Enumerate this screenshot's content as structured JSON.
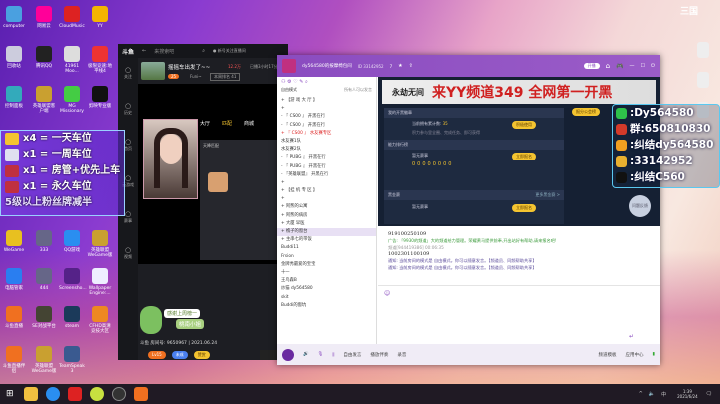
{
  "desktop_icons": [
    {
      "label": "computer",
      "color": "#4aa0e0"
    },
    {
      "label": "网易云",
      "color": "#f09"
    },
    {
      "label": "CloudMusic",
      "color": "#d22"
    },
    {
      "label": "YY",
      "color": "#f4b400"
    },
    {
      "label": "回收站",
      "color": "#ccd"
    },
    {
      "label": "腾讯QQ",
      "color": "#222"
    },
    {
      "label": "41961 Moo...",
      "color": "#ddd"
    },
    {
      "label": "极限竞速:地平线4",
      "color": "#e33"
    },
    {
      "label": "控制面板",
      "color": "#3ab"
    },
    {
      "label": "英雄联盟客户端",
      "color": "#c9a030"
    },
    {
      "label": "MG Missionary",
      "color": "#4c4"
    },
    {
      "label": "剪映专业版",
      "color": "#111"
    },
    {
      "label": "WeGame",
      "color": "#e8c020"
    },
    {
      "label": "333",
      "color": "#668"
    },
    {
      "label": "QQ游戏",
      "color": "#2a8ef0"
    },
    {
      "label": "英雄联盟WeGame版",
      "color": "#c9a030"
    },
    {
      "label": "电脑管家",
      "color": "#2a7ef0"
    },
    {
      "label": "444",
      "color": "#668"
    },
    {
      "label": "Screensho...",
      "color": "#528"
    },
    {
      "label": "Wallpaper Engine:...",
      "color": "#eef"
    },
    {
      "label": "斗鱼直播",
      "color": "#f07020"
    },
    {
      "label": "SE对战平台",
      "color": "#443"
    },
    {
      "label": "steam",
      "color": "#1b3a5a"
    },
    {
      "label": "CFHD高清竞技大区",
      "color": "#e82"
    },
    {
      "label": "斗鱼直播伴侣",
      "color": "#f07020"
    },
    {
      "label": "英雄联盟WeGame版",
      "color": "#c9a030"
    },
    {
      "label": "TeamSpeak 3",
      "color": "#3a5a90"
    }
  ],
  "right_icons": [
    {
      "label": "",
      "color": "#eee"
    },
    {
      "label": "",
      "color": "#eee"
    },
    {
      "label": "",
      "color": "#eee"
    }
  ],
  "douyu": {
    "search_placeholder": "来搜索吧",
    "follow_text": "● 新号关注直播间",
    "room_title": "摇摇车出发了~~",
    "hot": "12.2万",
    "online": "已播3小时17分",
    "level": "25",
    "anchor": "Funi~",
    "rank": "本周排名 41",
    "side": [
      "关注",
      "历史",
      "首页",
      "云游戏",
      "赛事",
      "视频"
    ],
    "tabs": [
      "大厅",
      "匹配",
      "商城"
    ],
    "team_label": "天降匹配",
    "footer": "斗鱼 房间号: 9650967 | 2021.06.24",
    "badges": [
      "Lv15",
      "未成",
      "赞赏"
    ],
    "sticker_text": [
      "感谢上周榜一",
      "桃南小姐"
    ]
  },
  "yy": {
    "channel_name": "dy564580的按摩椅包间",
    "channel_id": "ID 33142952",
    "members": "7",
    "top_btn": "开播",
    "mode": "自由模式",
    "mode_note": "所有人可以发言",
    "list": [
      "+ 【游 戏 大 厅 】",
      "+ ",
      "- 『 CS00 』 开黑在行",
      "- 『 CS00 』 开黑在行",
      "+ 『 CS00 』 水友赛专区",
      "水友赛1队",
      "水友赛2队",
      "- 『 PUBG 』 开黑在行",
      "- 『 PUBG 』 开黑在行",
      "- 『英雄联盟』 开黑在行",
      "+ ",
      "+ 【挂 机 专 区 】",
      "+ ",
      "+ 阿熊的公寓",
      "+ 阿熊的病房",
      "+ 大厦 早医",
      "+ 樵子的窗台",
      "+ 主串七的带饭",
      "Buddi11",
      "Frsion",
      "金牌秀最爱的宝宝",
      "十一",
      "王鸟森B",
      "炒猫 dy564580",
      "skit",
      "Buddi的窗坑"
    ],
    "banner": "来YY频道349 全网第一开黑",
    "banner_logo": "永劫无间",
    "sections": {
      "s1_title": "我的开黑徽章",
      "s1_text": "当前拥有累计数:",
      "s1_num": "35",
      "s1_sub": "积力参与里全圈、完成任务、即可获得",
      "s1_btn": "积极使用",
      "s2_title": "能力排行榜",
      "s2_name": "暂无赛事",
      "s2_btn": "立即报名",
      "digits": "00000000",
      "s3_title": "黑金赛",
      "s3_link": "更多黑金赛 >",
      "s3_name": "暂无赛事",
      "s3_btn": "立即报名",
      "side_btn": "报分公会榜",
      "help": "问题反馈"
    },
    "chat": [
      {
        "text": "919100250109"
      },
      {
        "type": "ad",
        "text": "广告: 「9930的频道」大的频道给力管理。荣耀黄马提供前奉,开出站好有帮助,请来报名吧!"
      },
      {
        "name": "频道[944419386] 00:06:35",
        "text": "1002301100109"
      },
      {
        "type": "notice",
        "text": "通知: 当前房间的模式是 自由模式。你可以随意发言。【频道员、同频帮助共享】"
      },
      {
        "type": "notice",
        "text": "通知: 当前房间的模式是 自由模式。你可以随意发言。【频道员、同频帮助共享】"
      }
    ],
    "bottom": {
      "free": "自由发言",
      "music": "播放伴奏",
      "record": "录音",
      "template": "频道模板",
      "apps": "应用中心"
    }
  },
  "overlay_left": [
    "x4 = 一天车位",
    "x1 = 一周车位",
    "x1 = 房管+优先上车",
    "x1 = 永久车位",
    "5级以上粉丝牌减半"
  ],
  "overlay_right": [
    {
      "text": ":Dy564580",
      "color": "#2ec24a"
    },
    {
      "text": "群:650810830",
      "color": "#d23a2a"
    },
    {
      "text": ":纠结dy564580",
      "color": "#f0a020"
    },
    {
      "text": ":33142952",
      "color": "#e8b030"
    },
    {
      "text": ":纠结C560",
      "color": "#111"
    }
  ],
  "taskbar": {
    "time": "1:39",
    "date": "2021/6/24",
    "ime": "中"
  }
}
